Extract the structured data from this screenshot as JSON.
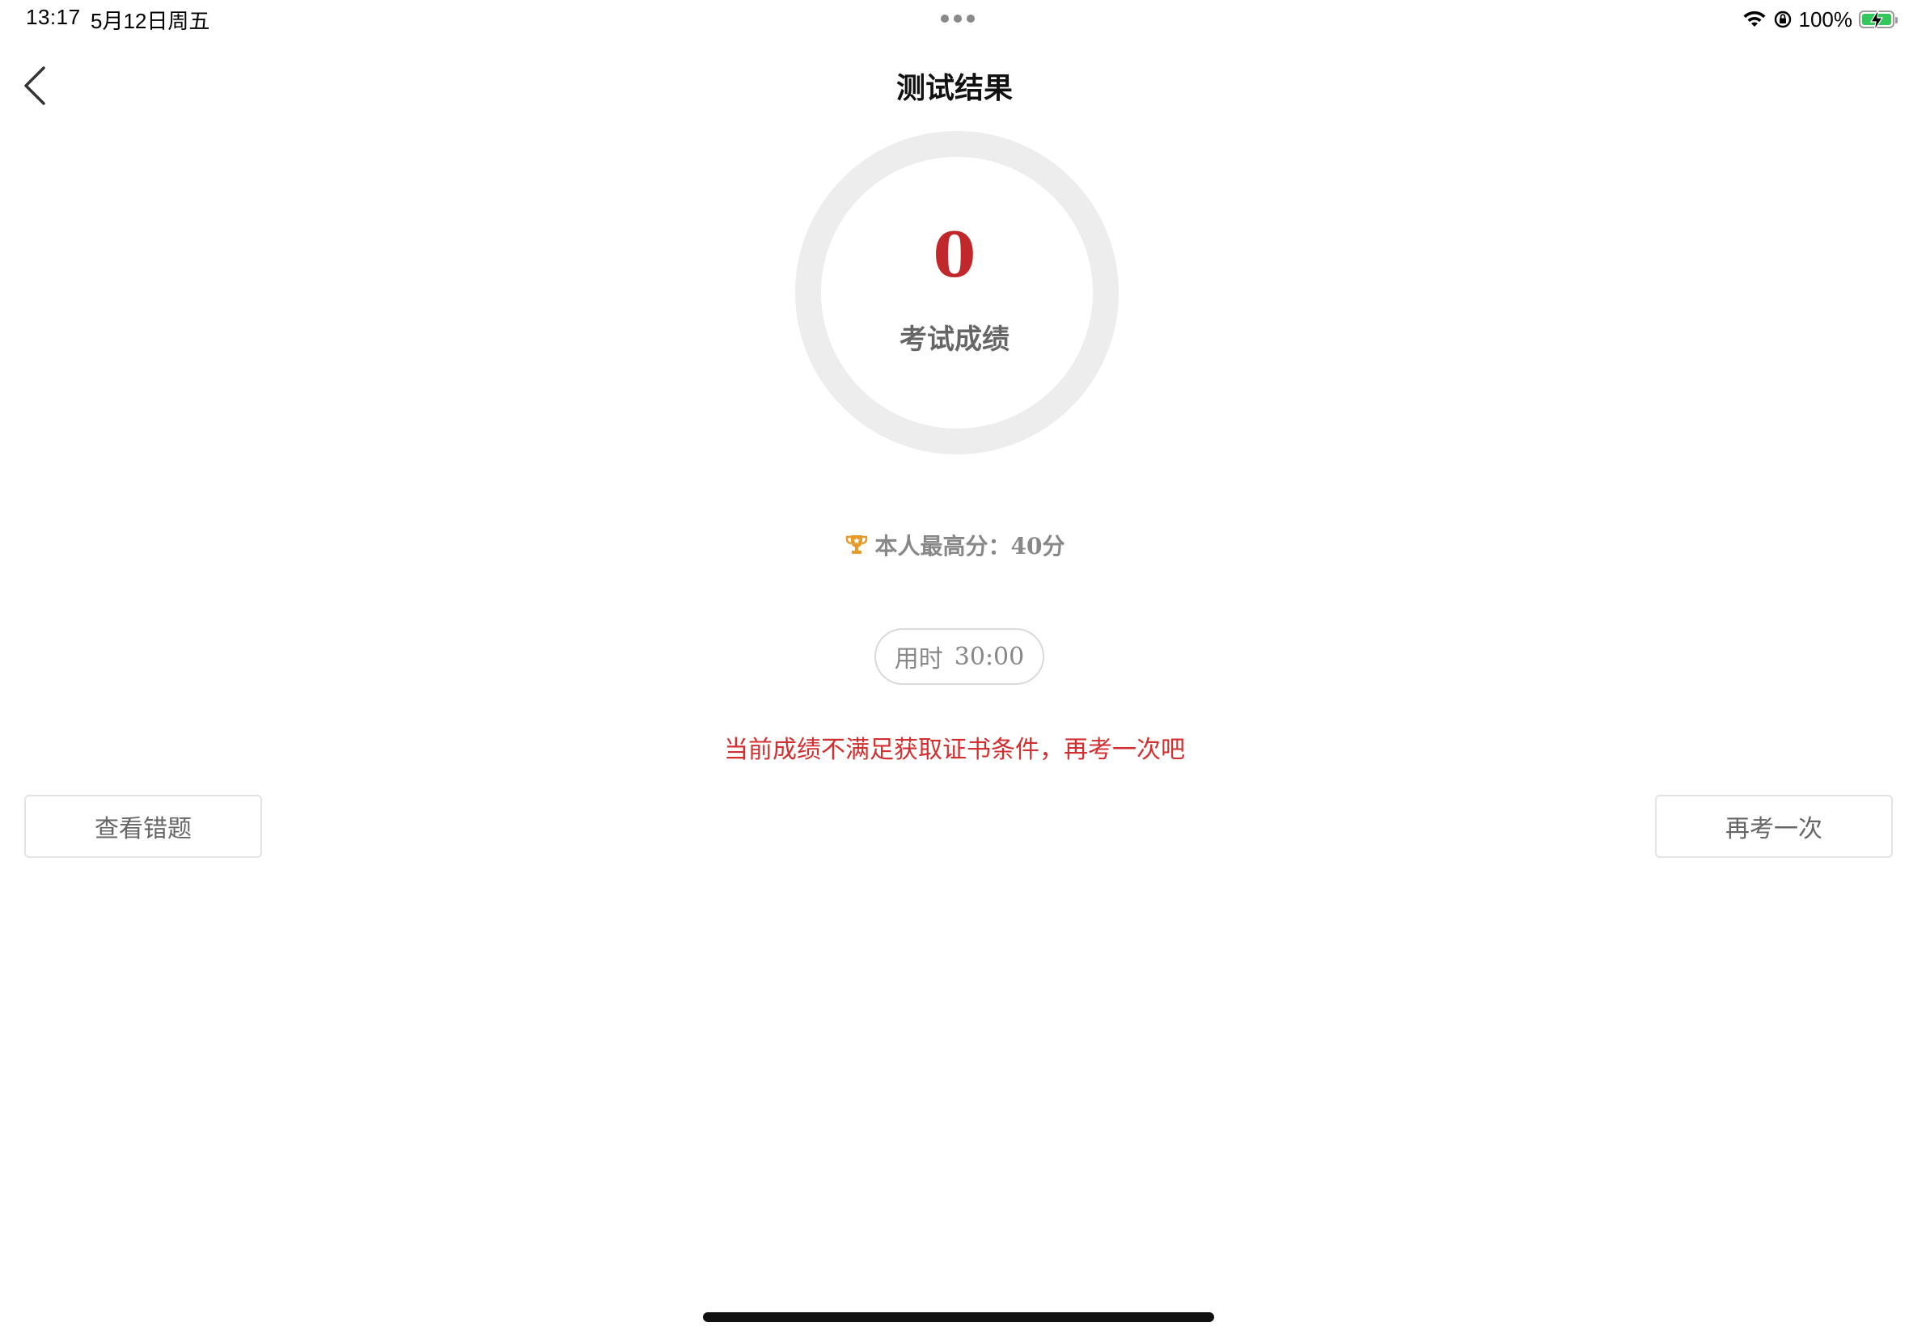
{
  "status_bar": {
    "time": "13:17",
    "date": "5月12日周五",
    "battery_text": "100%",
    "battery_level": 1.0,
    "battery_color": "#34c759"
  },
  "nav": {
    "title": "测试结果",
    "back_icon": "chevron-left-icon"
  },
  "result": {
    "score": "0",
    "score_label": "考试成绩",
    "score_color": "#c0282c",
    "ring_color": "#ededed",
    "best_icon": "trophy-icon",
    "best_score_text": "本人最高分：40分",
    "duration_label": "用时",
    "duration_value": "30:00",
    "message": "当前成绩不满足获取证书条件，再考一次吧",
    "message_color": "#d23030"
  },
  "actions": {
    "review_label": "查看错题",
    "retake_label": "再考一次"
  }
}
